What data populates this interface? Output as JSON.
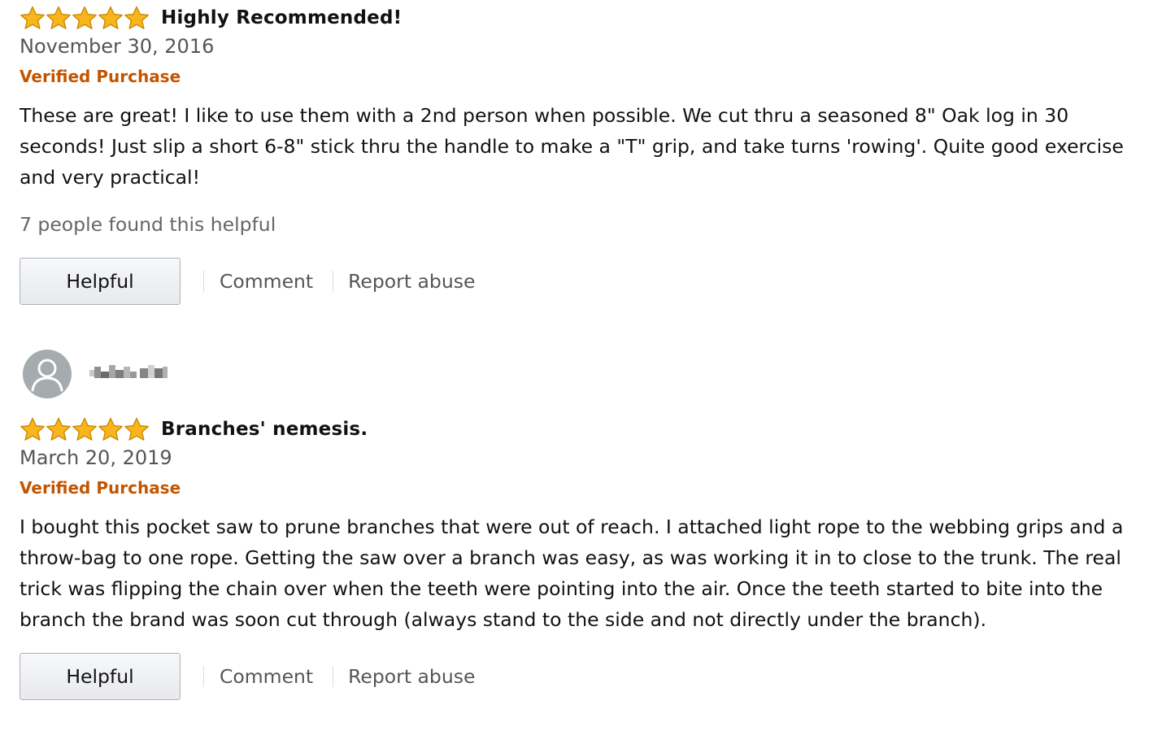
{
  "reviews": [
    {
      "rating": 5,
      "max_rating": 5,
      "title": "Highly Recommended!",
      "date": "November 30, 2016",
      "verified_label": "Verified Purchase",
      "body": "These are great! I like to use them with a 2nd person when possible. We cut thru a seasoned 8\" Oak log in 30 seconds! Just slip a short 6-8\" stick thru the handle to make a \"T\" grip, and take turns 'rowing'. Quite good exercise and very practical!",
      "helpful_count_text": "7 people found this helpful",
      "helpful_button": "Helpful",
      "comment_link": "Comment",
      "report_link": "Report abuse"
    },
    {
      "reviewer_icon": "default-user-avatar-icon",
      "rating": 5,
      "max_rating": 5,
      "title": "Branches' nemesis.",
      "date": "March 20, 2019",
      "verified_label": "Verified Purchase",
      "body": "I bought this pocket saw to prune branches that were out of reach. I attached light rope to the webbing grips and a throw-bag to one rope. Getting the saw over a branch was easy, as was working it in to close to the trunk. The real trick was flipping the chain over when the teeth were pointing into the air. Once the teeth started to bite into the branch the brand was soon cut through (always stand to the side and not directly under the branch).",
      "helpful_button": "Helpful",
      "comment_link": "Comment",
      "report_link": "Report abuse"
    }
  ],
  "colors": {
    "star_fill": "#f8b51c",
    "star_stroke": "#c98a04",
    "verified": "#c45500",
    "muted_text": "#555555",
    "avatar_bg": "#a4acad"
  }
}
